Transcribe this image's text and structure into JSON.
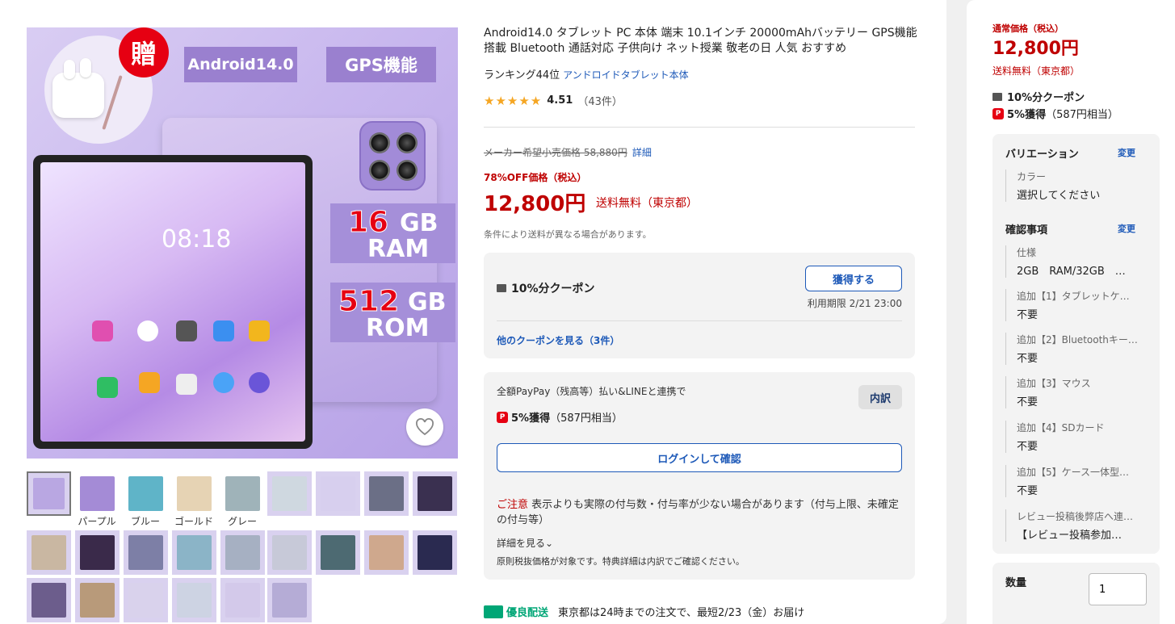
{
  "gallery": {
    "badge_gift": "贈",
    "tag_android": "Android14.0",
    "tag_gps": "GPS機能",
    "clock": "08:18",
    "ram_number": "16",
    "ram_unit_top": "GB",
    "ram_unit_bottom": "RAM",
    "rom_number": "512",
    "rom_unit_top": "GB",
    "rom_unit_bottom": "ROM",
    "color_labels": [
      "パープル",
      "ブルー",
      "ゴールド",
      "グレー"
    ]
  },
  "product": {
    "title": "Android14.0 タブレット PC 本体 端末 10.1インチ 20000mAhバッテリー GPS機能搭載 Bluetooth 通話対応 子供向け ネット授業 敬老の日 人気 おすすめ",
    "ranking_text": "ランキング44位",
    "ranking_link": "アンドロイドタブレット本体",
    "stars": "★★★★★",
    "rating": "4.51",
    "review_count": "（43件）",
    "list_price_text": "メーカー希望小売価格 58,880円",
    "list_price_link": "詳細",
    "discount_label": "78%OFF価格（税込）",
    "price": "12,800円",
    "shipping": "送料無料（東京都）",
    "shipping_note": "条件により送料が異なる場合があります。"
  },
  "coupon": {
    "title": "10%分クーポン",
    "button": "獲得する",
    "expiry": "利用期限 2/21 23:00",
    "more_link": "他のクーポンを見る（3件）"
  },
  "points": {
    "desc": "全額PayPay（残高等）払い&LINEと連携で",
    "breakdown": "内訳",
    "pp_icon": "P",
    "earn_bold": "5%獲得",
    "earn_rest": "（587円相当）",
    "login_button": "ログインして確認",
    "caution_red": "ご注意",
    "caution_text": " 表示よりも実際の付与数・付与率が少ない場合があります（付与上限、未確定の付与等）",
    "details_link": "詳細を見る",
    "tax_note": "原則税抜価格が対象です。特典詳細は内訳でご確認ください。"
  },
  "delivery": {
    "badge": "優良配送",
    "text": "東京都は24時までの注文で、最短2/23（金）お届け"
  },
  "sidebar": {
    "price_label": "通常価格（税込）",
    "price": "12,800円",
    "shipping": "送料無料（東京都）",
    "coupon": "10%分クーポン",
    "points_bold": "5%獲得",
    "points_rest": "（587円相当）",
    "variation_head": "バリエーション",
    "change": "変更",
    "color_label": "カラー",
    "color_value": "選択してください",
    "confirm_head": "確認事項",
    "options": [
      {
        "label": "仕様",
        "value": "2GB　RAM/32GB　…"
      },
      {
        "label": "追加【1】タブレットケ…",
        "value": "不要"
      },
      {
        "label": "追加【2】Bluetoothキー…",
        "value": "不要"
      },
      {
        "label": "追加【3】マウス",
        "value": "不要"
      },
      {
        "label": "追加【4】SDカード",
        "value": "不要"
      },
      {
        "label": "追加【5】ケース一体型…",
        "value": "不要"
      },
      {
        "label": "レビュー投稿後弊店へ連…",
        "value": "【レビュー投稿参加…"
      }
    ],
    "qty_label": "数量",
    "qty_value": "1"
  },
  "colors": {
    "price_red": "#bf0000",
    "link_blue": "#1d59b8",
    "delivery_green": "#00a676"
  }
}
